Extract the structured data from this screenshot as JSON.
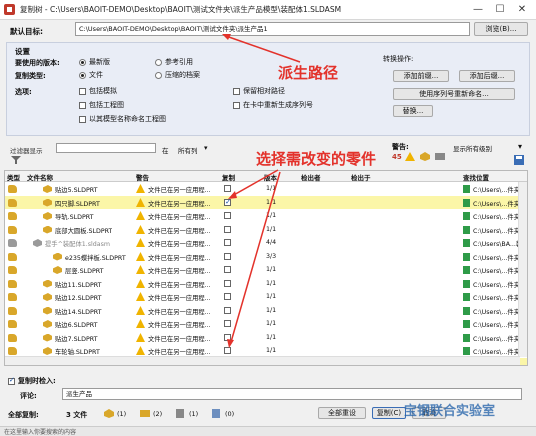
{
  "window": {
    "title": "复制树 - C:\\Users\\BAOIT-DEMO\\Desktop\\BAOIT\\测试文件夹\\派生产品模型\\装配体1.SLDASM",
    "minimize": "—",
    "maximize": "☐",
    "close": "✕"
  },
  "target": {
    "label": "默认目标:",
    "path": "C:\\Users\\BAOIT-DEMO\\Desktop\\BAOIT\\测试文件夹\\派生产品1",
    "browse": "浏览(B)..."
  },
  "settings": {
    "header": "设置",
    "version_label": "要使用的版本:",
    "version_latest": "最新版",
    "version_ref": "参考引用",
    "copy_type_label": "复制类型:",
    "copy_file": "文件",
    "copy_zip": "压缩的档案",
    "options_label": "选项:",
    "opt_simplified": "包括模拟",
    "opt_drawings": "包括工程图",
    "opt_name_drawings": "以其模型名称命名工程图",
    "opt_keep_relative": "保留相对路径",
    "opt_reorder_serial": "在卡中重新生成序列号",
    "convert_label": "转换操作:",
    "add_prefix": "添加前缀...",
    "add_suffix": "添加后缀...",
    "serial_rename": "使用序列号重新命名...",
    "replace": "替换..."
  },
  "filter": {
    "label": "过滤器显示",
    "in_label": "在",
    "in_value": "所有列",
    "warnings_label": "警告:",
    "warnings_count": "45",
    "display_label": "显示所有级别"
  },
  "table": {
    "headers": [
      "类型",
      "文件名称",
      "警告",
      "复制",
      "版本",
      "检出者",
      "检出于",
      "查找位置"
    ],
    "rows": [
      {
        "name": "贴边5.SLDPRT",
        "warning": "文件已在另一应用程...",
        "checked": false,
        "version": "1/1",
        "location": "C:\\Users\\...件夹\\标",
        "highlight": false,
        "indent": 1
      },
      {
        "name": "四只脚.SLDPRT",
        "warning": "文件已在另一应用程...",
        "checked": true,
        "version": "1/1",
        "location": "C:\\Users\\...件夹\\标",
        "highlight": true,
        "indent": 1
      },
      {
        "name": "导轨.SLDPRT",
        "warning": "文件已在另一应用程...",
        "checked": false,
        "version": "1/1",
        "location": "C:\\Users\\...件夹\\标",
        "highlight": false,
        "indent": 1
      },
      {
        "name": "底部大圆板.SLDPRT",
        "warning": "文件已在另一应用程...",
        "checked": false,
        "version": "1/1",
        "location": "C:\\Users\\...件夹\\标",
        "highlight": false,
        "indent": 1
      },
      {
        "name": "提手^装配体1.sldasm",
        "warning": "文件已在另一应用程...",
        "checked": false,
        "version": "4/4",
        "location": "C:\\Users\\BA...装配",
        "highlight": false,
        "indent": 0,
        "grey": true
      },
      {
        "name": "e235蝶拌板.SLDPRT",
        "warning": "文件已在另一应用程...",
        "checked": false,
        "version": "3/3",
        "location": "C:\\Users\\...件夹\\标",
        "highlight": false,
        "indent": 2
      },
      {
        "name": "层竖.SLDPRT",
        "warning": "文件已在另一应用程...",
        "checked": false,
        "version": "1/1",
        "location": "C:\\Users\\...件夹\\标",
        "highlight": false,
        "indent": 2
      },
      {
        "name": "贴边11.SLDPRT",
        "warning": "文件已在另一应用程...",
        "checked": false,
        "version": "1/1",
        "location": "C:\\Users\\...件夹\\标",
        "highlight": false,
        "indent": 1
      },
      {
        "name": "贴边12.SLDPRT",
        "warning": "文件已在另一应用程...",
        "checked": false,
        "version": "1/1",
        "location": "C:\\Users\\...件夹\\标",
        "highlight": false,
        "indent": 1
      },
      {
        "name": "贴边14.SLDPRT",
        "warning": "文件已在另一应用程...",
        "checked": false,
        "version": "1/1",
        "location": "C:\\Users\\...件夹\\标",
        "highlight": false,
        "indent": 1
      },
      {
        "name": "贴边6.SLDPRT",
        "warning": "文件已在另一应用程...",
        "checked": false,
        "version": "1/1",
        "location": "C:\\Users\\...件夹\\标",
        "highlight": false,
        "indent": 1
      },
      {
        "name": "贴边7.SLDPRT",
        "warning": "文件已在另一应用程...",
        "checked": false,
        "version": "1/1",
        "location": "C:\\Users\\...件夹\\标",
        "highlight": false,
        "indent": 1
      },
      {
        "name": "车轮轴.SLDPRT",
        "warning": "文件已在另一应用程...",
        "checked": false,
        "version": "1/1",
        "location": "C:\\Users\\...件夹\\标",
        "highlight": false,
        "indent": 1
      },
      {
        "name": "轮子.SLDPRT",
        "warning": "文件已在另一应用程...",
        "checked": true,
        "version": "1/1",
        "location": "C:\\Users\\...件夹\\标",
        "highlight": true,
        "indent": 1
      }
    ]
  },
  "bottom": {
    "checkin_label": "复制时检入:",
    "comment_label": "评论:",
    "comment_value": "派生产品",
    "total_label": "全部复制:",
    "total_files": "3 文件",
    "count1": "(1)",
    "count2": "(2)",
    "count3": "(1)",
    "count4": "(0)",
    "reset_button": "全部重设",
    "copy_button": "复制(C)",
    "cancel_button": "取消"
  },
  "annotations": {
    "path_note": "派生路径",
    "parts_note": "选择需改变的零件"
  },
  "watermark": "宝钢联合实验室",
  "taskbar_text": "在这里输入你要搜索的内容",
  "colors": {
    "highlight_row": "#fbf6a8",
    "annotation": "#e3322b"
  }
}
